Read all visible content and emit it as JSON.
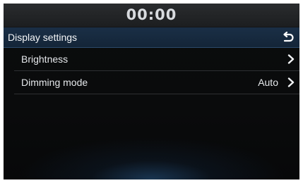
{
  "status_bar": {
    "clock": "00:00"
  },
  "header": {
    "title": "Display settings",
    "back_icon": "back-arrow-icon"
  },
  "menu": {
    "items": [
      {
        "label": "Brightness",
        "value": "",
        "icon": "chevron-right-icon"
      },
      {
        "label": "Dimming mode",
        "value": "Auto",
        "icon": "chevron-right-icon"
      }
    ]
  }
}
